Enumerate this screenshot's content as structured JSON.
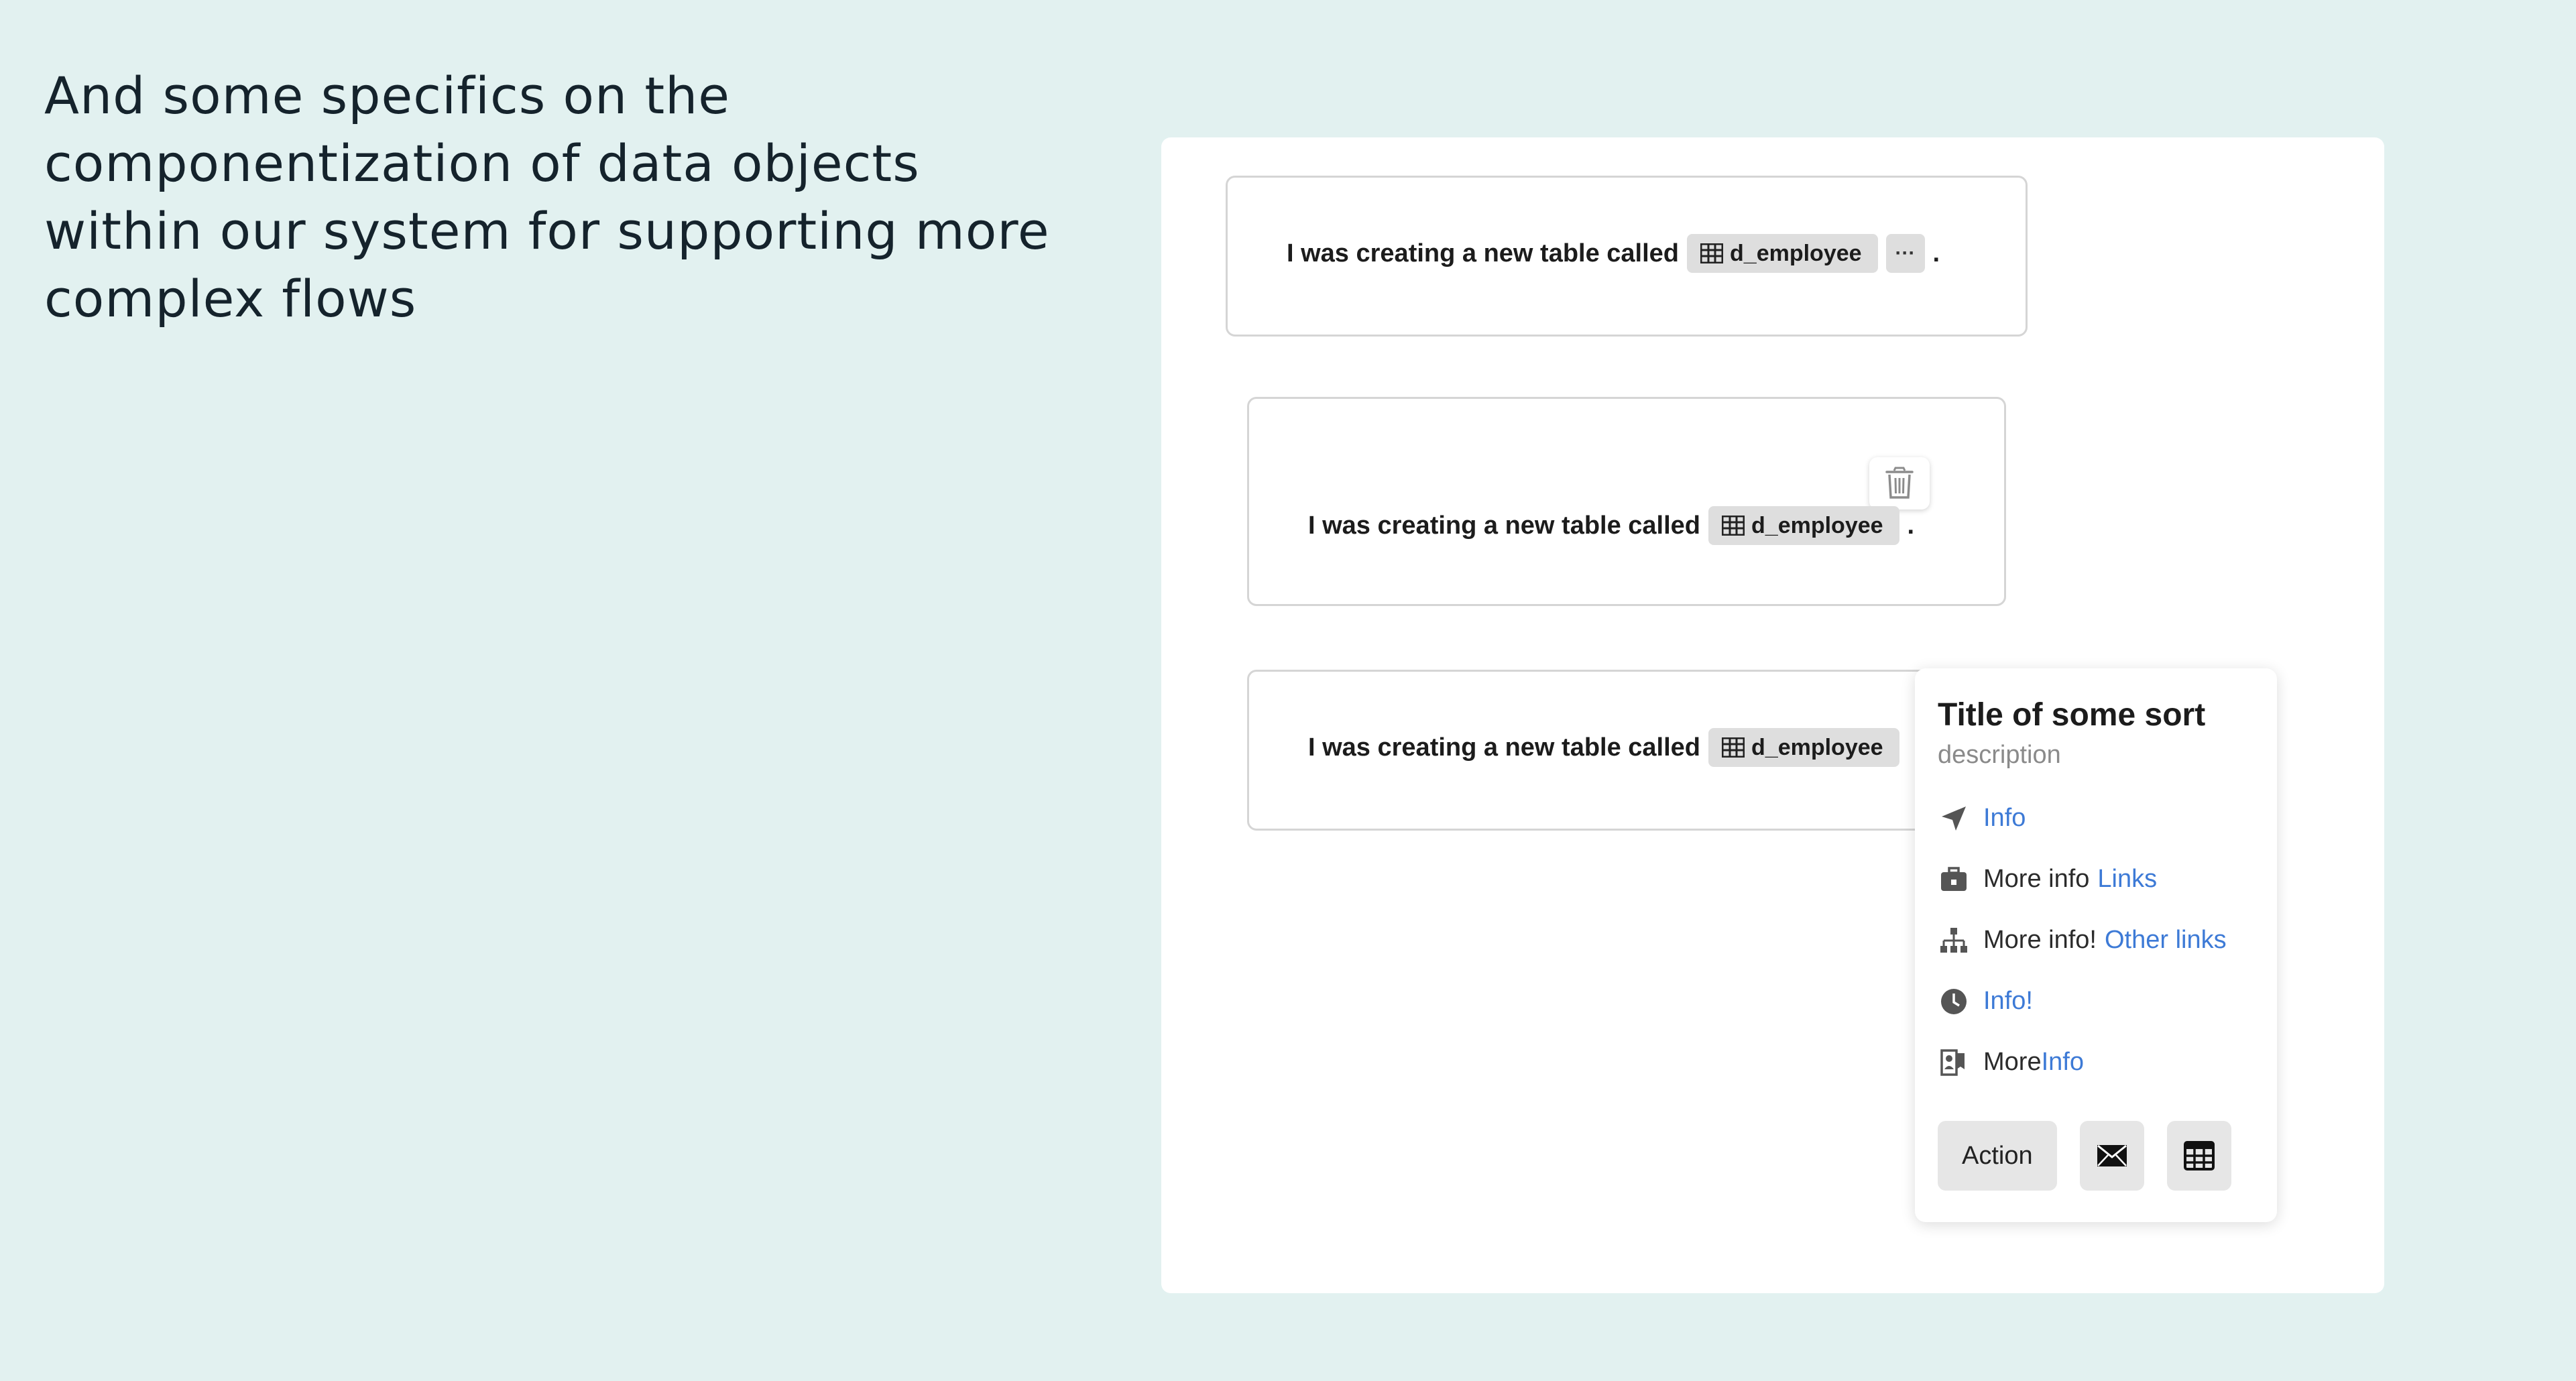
{
  "slide": {
    "heading": "And some specifics on the componentization of data objects within our system for supporting more complex flows"
  },
  "cards": [
    {
      "sentence": "I was creating a new table called",
      "chip_label": "d_employee",
      "more_label": "···",
      "period": "."
    },
    {
      "sentence": "I was creating a new table called",
      "chip_label": "d_employee",
      "period": "."
    },
    {
      "sentence": "I was creating a new table called",
      "chip_label": "d_employee"
    }
  ],
  "popover": {
    "title": "Title of some sort",
    "description": "description",
    "rows": [
      {
        "icon": "location-arrow-icon",
        "text": "",
        "link": "Info"
      },
      {
        "icon": "briefcase-icon",
        "text": "More info",
        "link": "Links"
      },
      {
        "icon": "org-chart-icon",
        "text": "More info!",
        "link": "Other links"
      },
      {
        "icon": "clock-icon",
        "text": "",
        "link": "Info!"
      },
      {
        "icon": "badge-icon",
        "text": "More",
        "link": "Info"
      }
    ],
    "action_label": "Action",
    "action_icons": [
      "mail-icon",
      "table-icon"
    ]
  },
  "colors": {
    "background": "#e2f1f0",
    "chip": "#dedede",
    "link": "#3d7ad6"
  }
}
